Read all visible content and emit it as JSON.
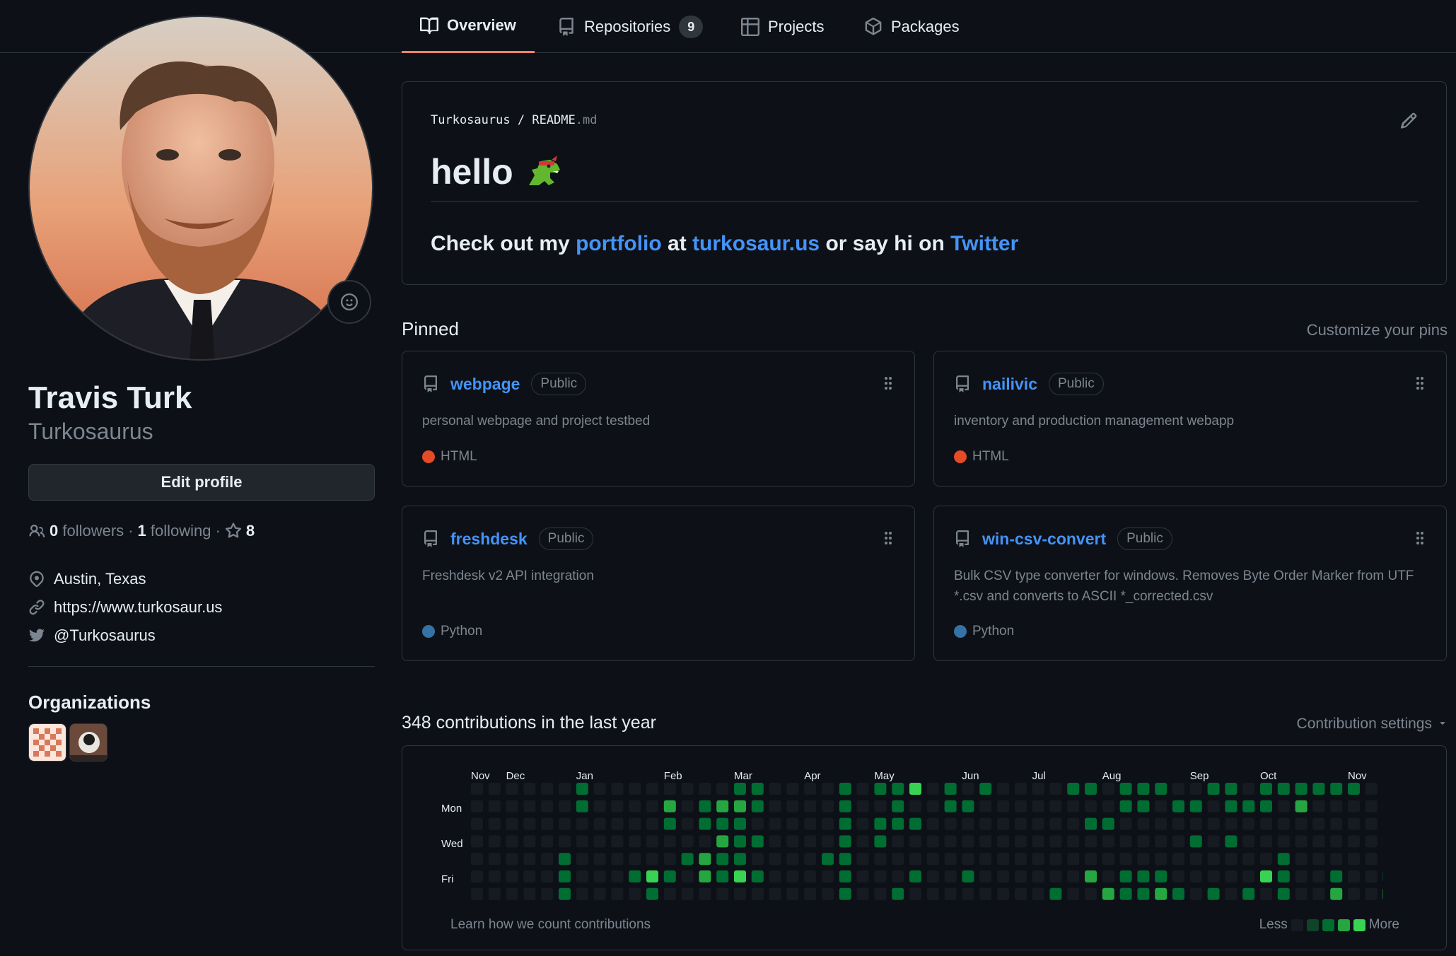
{
  "tabs": [
    {
      "label": "Overview",
      "icon": "book-icon",
      "active": true
    },
    {
      "label": "Repositories",
      "icon": "repo-icon",
      "count": "9"
    },
    {
      "label": "Projects",
      "icon": "table-icon"
    },
    {
      "label": "Packages",
      "icon": "package-icon"
    }
  ],
  "profile": {
    "full_name": "Travis Turk",
    "username": "Turkosaurus",
    "edit_label": "Edit profile",
    "followers_count": "0",
    "followers_label": "followers",
    "following_count": "1",
    "following_label": "following",
    "stars_count": "8",
    "separator": "·",
    "location": "Austin, Texas",
    "website": "https://www.turkosaur.us",
    "twitter": "@Turkosaurus",
    "organizations_title": "Organizations"
  },
  "readme": {
    "owner": "Turkosaurus",
    "separator": "/",
    "file_base": "README",
    "file_ext": ".md",
    "heading": "hello",
    "text_1": "Check out my ",
    "link_1": "portfolio",
    "text_2": " at ",
    "link_2": "turkosaur.us",
    "text_3": " or say hi on ",
    "link_3": "Twitter"
  },
  "pinned": {
    "title": "Pinned",
    "customize_label": "Customize your pins",
    "repos": [
      {
        "name": "webpage",
        "visibility": "Public",
        "description": "personal webpage and project testbed",
        "language": "HTML",
        "language_color": "#e34c26"
      },
      {
        "name": "nailivic",
        "visibility": "Public",
        "description": "inventory and production management webapp",
        "language": "HTML",
        "language_color": "#e34c26"
      },
      {
        "name": "freshdesk",
        "visibility": "Public",
        "description": "Freshdesk v2 API integration",
        "language": "Python",
        "language_color": "#3572a5"
      },
      {
        "name": "win-csv-convert",
        "visibility": "Public",
        "description": "Bulk CSV type converter for windows. Removes Byte Order Marker from UTF *.csv and converts to ASCII *_corrected.csv",
        "language": "Python",
        "language_color": "#3572a5"
      }
    ]
  },
  "contributions": {
    "title": "348 contributions in the last year",
    "settings_label": "Contribution settings",
    "months": [
      "Nov",
      "Dec",
      "Jan",
      "Feb",
      "Mar",
      "Apr",
      "May",
      "Jun",
      "Jul",
      "Aug",
      "Sep",
      "Oct",
      "Nov"
    ],
    "month_weeks": [
      0,
      2,
      6,
      11,
      15,
      19,
      23,
      28,
      32,
      36,
      41,
      45,
      50
    ],
    "day_labels": [
      "Mon",
      "Wed",
      "Fri"
    ],
    "learn_label": "Learn how we count contributions",
    "legend_less": "Less",
    "legend_more": "More",
    "level_colors": [
      "#161b22",
      "#0e4429",
      "#006d32",
      "#26a641",
      "#39d353"
    ],
    "grid": [
      "0000000000000000000000000000000000000000000000000000",
      "0000000000000000000000000000000000000000000000000000",
      "0000000000000000000000000000000000000000000000000000",
      "0000000000000000000000000000000000000000000000000000",
      "0000000000000000000000000000000000000000000000000000",
      "0000000000000000000000000000000000000000000000000000",
      "0000000000000000000000000000000000000000000000000000"
    ],
    "active_cells": [
      [
        6,
        0,
        2
      ],
      [
        15,
        0,
        2
      ],
      [
        16,
        0,
        2
      ],
      [
        21,
        0,
        2
      ],
      [
        23,
        0,
        2
      ],
      [
        24,
        0,
        2
      ],
      [
        25,
        0,
        4
      ],
      [
        27,
        0,
        2
      ],
      [
        29,
        0,
        2
      ],
      [
        34,
        0,
        2
      ],
      [
        35,
        0,
        2
      ],
      [
        37,
        0,
        2
      ],
      [
        38,
        0,
        2
      ],
      [
        39,
        0,
        2
      ],
      [
        42,
        0,
        2
      ],
      [
        43,
        0,
        2
      ],
      [
        45,
        0,
        2
      ],
      [
        46,
        0,
        2
      ],
      [
        47,
        0,
        2
      ],
      [
        48,
        0,
        2
      ],
      [
        49,
        0,
        2
      ],
      [
        50,
        0,
        2
      ],
      [
        6,
        1,
        2
      ],
      [
        11,
        1,
        3
      ],
      [
        13,
        1,
        2
      ],
      [
        14,
        1,
        3
      ],
      [
        15,
        1,
        3
      ],
      [
        16,
        1,
        2
      ],
      [
        21,
        1,
        2
      ],
      [
        24,
        1,
        2
      ],
      [
        27,
        1,
        2
      ],
      [
        28,
        1,
        2
      ],
      [
        37,
        1,
        2
      ],
      [
        38,
        1,
        2
      ],
      [
        40,
        1,
        2
      ],
      [
        41,
        1,
        2
      ],
      [
        43,
        1,
        2
      ],
      [
        44,
        1,
        2
      ],
      [
        45,
        1,
        2
      ],
      [
        47,
        1,
        3
      ],
      [
        11,
        2,
        2
      ],
      [
        13,
        2,
        2
      ],
      [
        14,
        2,
        2
      ],
      [
        15,
        2,
        2
      ],
      [
        21,
        2,
        2
      ],
      [
        23,
        2,
        2
      ],
      [
        24,
        2,
        2
      ],
      [
        25,
        2,
        2
      ],
      [
        35,
        2,
        2
      ],
      [
        36,
        2,
        2
      ],
      [
        14,
        3,
        3
      ],
      [
        15,
        3,
        2
      ],
      [
        16,
        3,
        2
      ],
      [
        21,
        3,
        2
      ],
      [
        23,
        3,
        2
      ],
      [
        41,
        3,
        2
      ],
      [
        43,
        3,
        2
      ],
      [
        5,
        4,
        2
      ],
      [
        12,
        4,
        2
      ],
      [
        13,
        4,
        3
      ],
      [
        14,
        4,
        2
      ],
      [
        15,
        4,
        2
      ],
      [
        20,
        4,
        2
      ],
      [
        21,
        4,
        2
      ],
      [
        46,
        4,
        2
      ],
      [
        5,
        5,
        2
      ],
      [
        9,
        5,
        2
      ],
      [
        10,
        5,
        4
      ],
      [
        11,
        5,
        2
      ],
      [
        13,
        5,
        3
      ],
      [
        14,
        5,
        2
      ],
      [
        15,
        5,
        4
      ],
      [
        16,
        5,
        2
      ],
      [
        21,
        5,
        2
      ],
      [
        25,
        5,
        2
      ],
      [
        28,
        5,
        2
      ],
      [
        35,
        5,
        3
      ],
      [
        37,
        5,
        2
      ],
      [
        38,
        5,
        2
      ],
      [
        39,
        5,
        2
      ],
      [
        45,
        5,
        4
      ],
      [
        46,
        5,
        2
      ],
      [
        49,
        5,
        2
      ],
      [
        52,
        5,
        2
      ],
      [
        5,
        6,
        2
      ],
      [
        10,
        6,
        2
      ],
      [
        21,
        6,
        2
      ],
      [
        24,
        6,
        2
      ],
      [
        33,
        6,
        2
      ],
      [
        36,
        6,
        3
      ],
      [
        37,
        6,
        2
      ],
      [
        38,
        6,
        2
      ],
      [
        39,
        6,
        3
      ],
      [
        40,
        6,
        2
      ],
      [
        42,
        6,
        2
      ],
      [
        44,
        6,
        2
      ],
      [
        46,
        6,
        2
      ],
      [
        49,
        6,
        3
      ],
      [
        52,
        6,
        4
      ]
    ]
  }
}
